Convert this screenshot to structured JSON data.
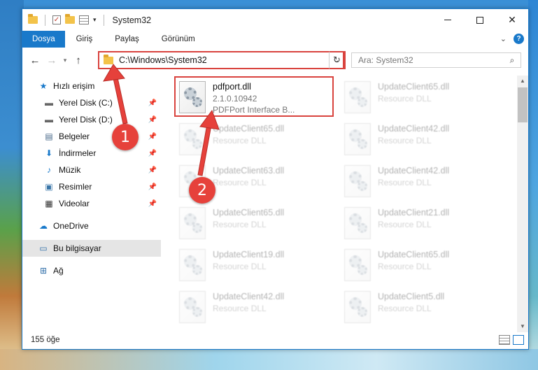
{
  "window": {
    "title": "System32"
  },
  "ribbon": {
    "tabs": [
      "Dosya",
      "Giriş",
      "Paylaş",
      "Görünüm"
    ]
  },
  "nav": {
    "address": "C:\\Windows\\System32",
    "search_placeholder": "Ara: System32"
  },
  "sidebar": {
    "quick_access": "Hızlı erişim",
    "items": [
      {
        "label": "Yerel Disk (C:)",
        "icon": "drive-icon",
        "pinned": true
      },
      {
        "label": "Yerel Disk (D:)",
        "icon": "drive-icon",
        "pinned": true
      },
      {
        "label": "Belgeler",
        "icon": "documents-icon",
        "pinned": true
      },
      {
        "label": "İndirmeler",
        "icon": "downloads-icon",
        "pinned": true
      },
      {
        "label": "Müzik",
        "icon": "music-icon",
        "pinned": true
      },
      {
        "label": "Resimler",
        "icon": "pictures-icon",
        "pinned": true
      },
      {
        "label": "Videolar",
        "icon": "videos-icon",
        "pinned": true
      }
    ],
    "onedrive": "OneDrive",
    "this_pc": "Bu bilgisayar",
    "network": "Ağ"
  },
  "files": [
    {
      "name": "pdfport.dll",
      "line1": "2.1.0.10942",
      "line2": "PDFPort Interface B...",
      "highlighted": true
    },
    {
      "name": "UpdateClient65.dll",
      "line1": "Resource DLL"
    },
    {
      "name": "UpdateClient65.dll",
      "line1": "Resource DLL"
    },
    {
      "name": "UpdateClient42.dll",
      "line1": "Resource DLL"
    },
    {
      "name": "UpdateClient63.dll",
      "line1": "Resource DLL"
    },
    {
      "name": "UpdateClient42.dll",
      "line1": "Resource DLL"
    },
    {
      "name": "UpdateClient65.dll",
      "line1": "Resource DLL"
    },
    {
      "name": "UpdateClient21.dll",
      "line1": "Resource DLL"
    },
    {
      "name": "UpdateClient19.dll",
      "line1": "Resource DLL"
    },
    {
      "name": "UpdateClient65.dll",
      "line1": "Resource DLL"
    },
    {
      "name": "UpdateClient42.dll",
      "line1": "Resource DLL"
    },
    {
      "name": "UpdateClient5.dll",
      "line1": "Resource DLL"
    }
  ],
  "status": {
    "item_count": "155 öğe"
  },
  "callouts": {
    "one": "1",
    "two": "2"
  },
  "colors": {
    "accent": "#1979ca",
    "highlight_red": "#d9433e",
    "callout_red": "#e6413b"
  }
}
